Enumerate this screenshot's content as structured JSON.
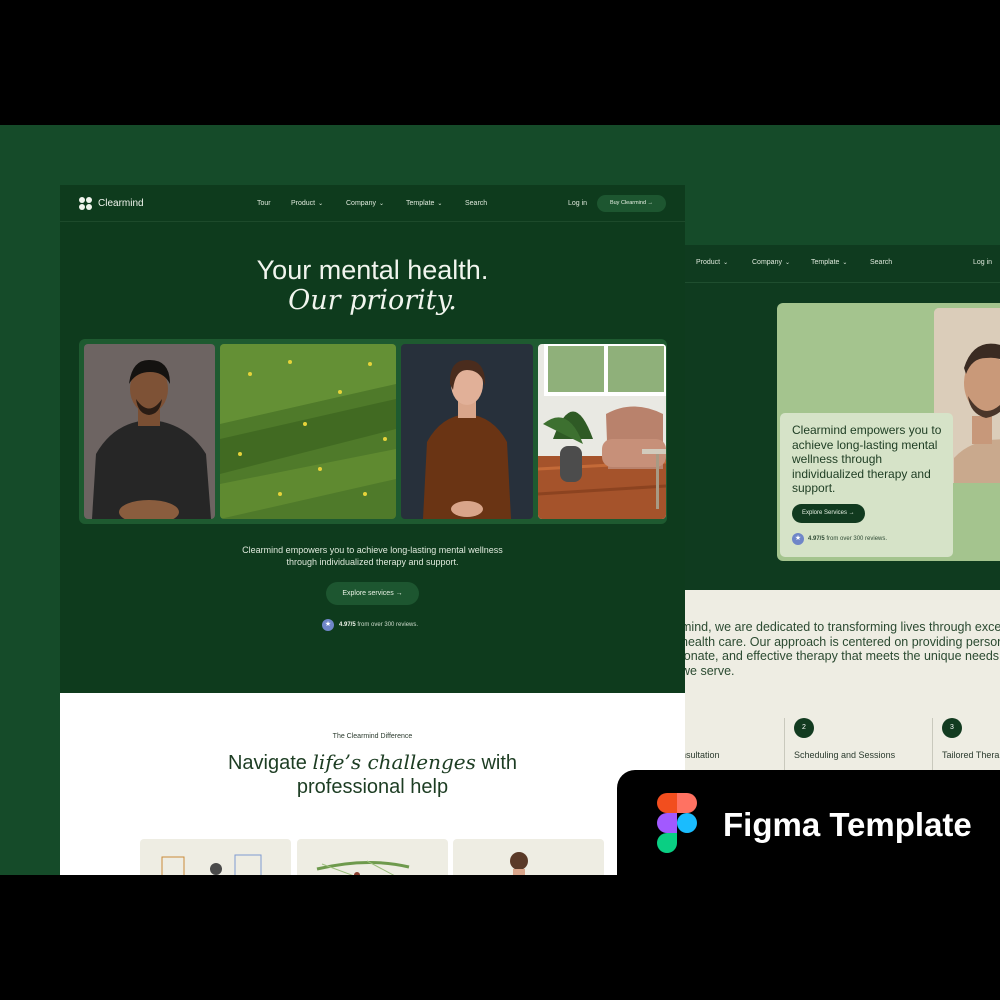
{
  "front": {
    "brand": "Clearmind",
    "nav": [
      {
        "label": "Tour",
        "dropdown": false
      },
      {
        "label": "Product",
        "dropdown": true
      },
      {
        "label": "Company",
        "dropdown": true
      },
      {
        "label": "Template",
        "dropdown": true
      },
      {
        "label": "Search",
        "dropdown": false
      }
    ],
    "login": "Log in",
    "buy": "Buy Clearmind →",
    "headline_1": "Your mental health.",
    "headline_2": "Our priority.",
    "description_1": "Clearmind empowers you to achieve long-lasting mental wellness",
    "description_2": "through individualized therapy and support.",
    "explore": "Explore services →",
    "rating_score": "4.97/5",
    "rating_text": "from over 300 reviews.",
    "section_eyebrow": "The Clearmind Difference",
    "section_heading_pre": "Navigate ",
    "section_heading_em": "life’s challenges",
    "section_heading_post": " with",
    "section_heading_line2": "professional help"
  },
  "back": {
    "nav": [
      {
        "label": "Product",
        "dropdown": true
      },
      {
        "label": "Company",
        "dropdown": true
      },
      {
        "label": "Template",
        "dropdown": true
      },
      {
        "label": "Search",
        "dropdown": false
      }
    ],
    "login": "Log in",
    "card_text": "Clearmind empowers you to achieve long-lasting mental wellness through individualized therapy and support.",
    "card_button": "Explore Services →",
    "rating_score": "4.97/5",
    "rating_text": "from over 300 reviews.",
    "paragraph": [
      "mind, we are dedicated to transforming lives through excep",
      "health care. Our approach is centered on providing personal",
      "ionate, and effective therapy that meets the unique needs",
      " we serve."
    ],
    "steps": [
      {
        "number": "",
        "label": "nsultation"
      },
      {
        "number": "2",
        "label": "Scheduling and Sessions"
      },
      {
        "number": "3",
        "label": "Tailored Thera"
      }
    ]
  },
  "badge": {
    "title": "Figma Template"
  },
  "colors": {
    "backdrop": "#154b29",
    "hero": "#0e3b1d",
    "accent_button": "#1d5630",
    "light_green_card": "#a4c48e",
    "cream": "#eeede3"
  },
  "icons": [
    "clearmind-logo-icon",
    "chevron-down-icon",
    "arrow-right-icon",
    "star-icon",
    "figma-logo-icon"
  ]
}
